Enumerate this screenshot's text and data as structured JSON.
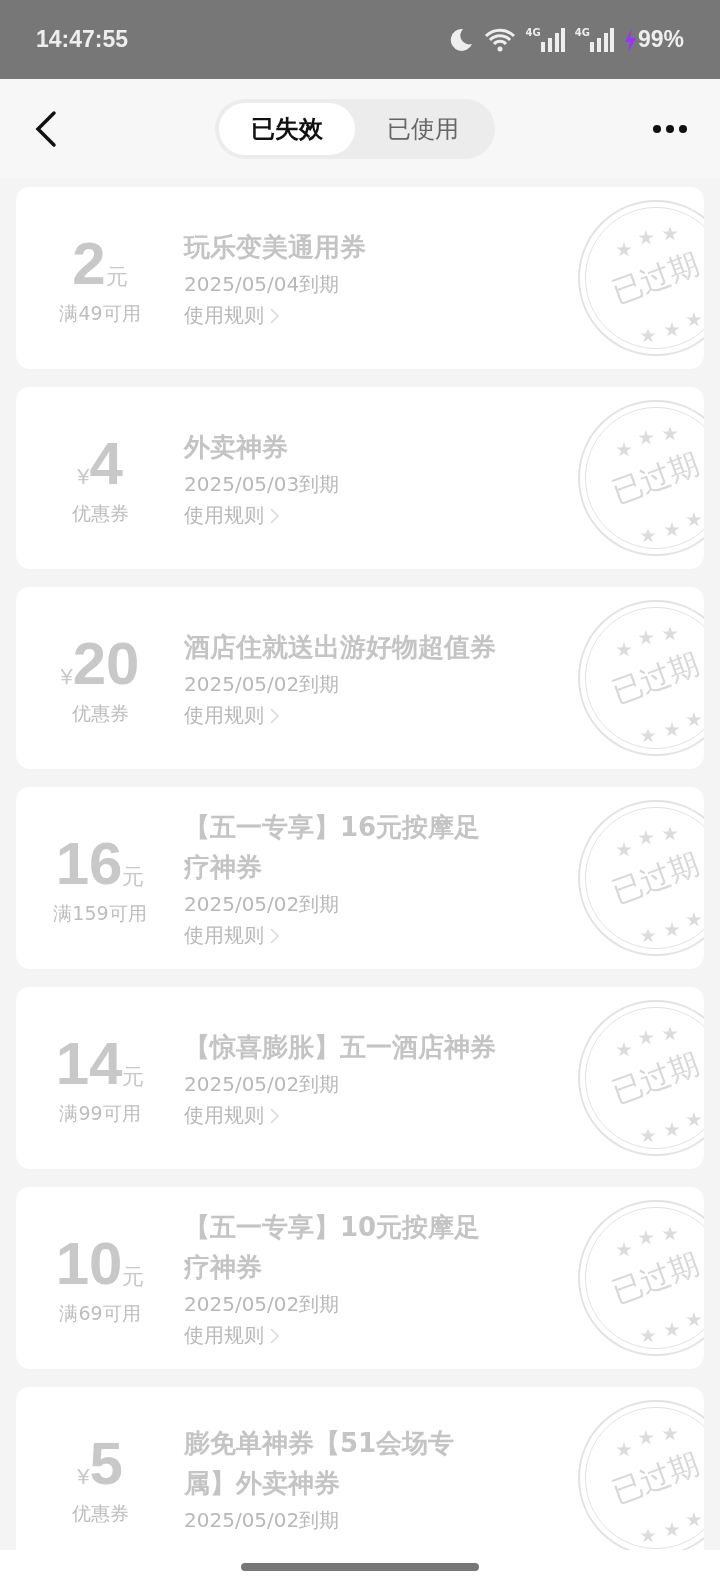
{
  "status_bar": {
    "time": "14:47:55",
    "networks": [
      "4G",
      "4G"
    ],
    "battery": "99%",
    "charging": true
  },
  "header": {
    "tabs": [
      {
        "label": "已失效",
        "selected": true
      },
      {
        "label": "已使用",
        "selected": false
      }
    ]
  },
  "coupons": [
    {
      "amount": "2",
      "currency": "元",
      "kind": "suffixed",
      "condition": "满49可用",
      "title": "玩乐变美通用券",
      "expiry": "2025/05/04到期",
      "rules_link": "使用规则",
      "stamp": "已过期"
    },
    {
      "amount": "4",
      "currency": "¥",
      "kind": "prefixed",
      "condition": "优惠券",
      "title": "外卖神券",
      "expiry": "2025/05/03到期",
      "rules_link": "使用规则",
      "stamp": "已过期"
    },
    {
      "amount": "20",
      "currency": "¥",
      "kind": "prefixed",
      "condition": "优惠券",
      "title": "酒店住就送出游好物超值券",
      "expiry": "2025/05/02到期",
      "rules_link": "使用规则",
      "stamp": "已过期"
    },
    {
      "amount": "16",
      "currency": "元",
      "kind": "suffixed",
      "condition": "满159可用",
      "title": "【五一专享】16元按摩足疗神券",
      "expiry": "2025/05/02到期",
      "rules_link": "使用规则",
      "stamp": "已过期"
    },
    {
      "amount": "14",
      "currency": "元",
      "kind": "suffixed",
      "condition": "满99可用",
      "title": "【惊喜膨胀】五一酒店神券",
      "expiry": "2025/05/02到期",
      "rules_link": "使用规则",
      "stamp": "已过期"
    },
    {
      "amount": "10",
      "currency": "元",
      "kind": "suffixed",
      "condition": "满69可用",
      "title": "【五一专享】10元按摩足疗神券",
      "expiry": "2025/05/02到期",
      "rules_link": "使用规则",
      "stamp": "已过期"
    },
    {
      "amount": "5",
      "currency": "¥",
      "kind": "prefixed",
      "condition": "优惠券",
      "title": "膨免单神券【51会场专属】外卖神券",
      "expiry": "2025/05/02到期",
      "stamp": "已过期"
    }
  ]
}
